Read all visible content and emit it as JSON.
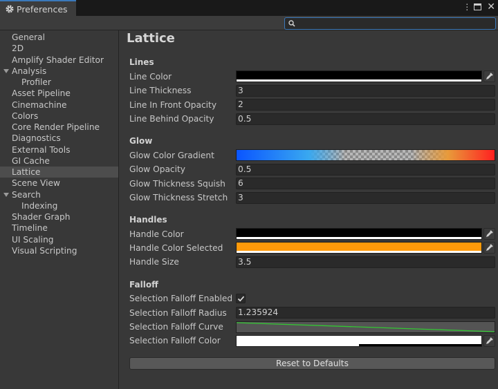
{
  "window": {
    "tab_title": "Preferences",
    "icons": [
      "gear-icon",
      "kebab-menu-icon",
      "maximize-icon",
      "close-icon"
    ]
  },
  "search": {
    "value": "",
    "placeholder": ""
  },
  "sidebar": {
    "items": [
      {
        "label": "General"
      },
      {
        "label": "2D"
      },
      {
        "label": "Amplify Shader Editor"
      },
      {
        "label": "Analysis",
        "expanded": true
      },
      {
        "label": "Profiler",
        "child": true
      },
      {
        "label": "Asset Pipeline"
      },
      {
        "label": "Cinemachine"
      },
      {
        "label": "Colors"
      },
      {
        "label": "Core Render Pipeline"
      },
      {
        "label": "Diagnostics"
      },
      {
        "label": "External Tools"
      },
      {
        "label": "GI Cache"
      },
      {
        "label": "Lattice",
        "selected": true
      },
      {
        "label": "Scene View"
      },
      {
        "label": "Search",
        "expanded": true
      },
      {
        "label": "Indexing",
        "child": true
      },
      {
        "label": "Shader Graph"
      },
      {
        "label": "Timeline"
      },
      {
        "label": "UI Scaling"
      },
      {
        "label": "Visual Scripting"
      }
    ]
  },
  "page": {
    "title": "Lattice",
    "lines": {
      "heading": "Lines",
      "line_color_label": "Line Color",
      "line_color": "#000000",
      "line_thickness_label": "Line Thickness",
      "line_thickness": "3",
      "front_opacity_label": "Line In Front Opacity",
      "front_opacity": "2",
      "behind_opacity_label": "Line Behind Opacity",
      "behind_opacity": "0.5"
    },
    "glow": {
      "heading": "Glow",
      "gradient_label": "Glow Color Gradient",
      "opacity_label": "Glow Opacity",
      "opacity": "0.5",
      "squish_label": "Glow Thickness Squish",
      "squish": "6",
      "stretch_label": "Glow Thickness Stretch",
      "stretch": "3"
    },
    "handles": {
      "heading": "Handles",
      "color_label": "Handle Color",
      "color": "#000000",
      "selected_label": "Handle Color Selected",
      "selected_color": "#ff9a0a",
      "size_label": "Handle Size",
      "size": "3.5"
    },
    "falloff": {
      "heading": "Falloff",
      "enabled_label": "Selection Falloff Enabled",
      "enabled": true,
      "radius_label": "Selection Falloff Radius",
      "radius": "1.235924",
      "curve_label": "Selection Falloff Curve",
      "color_label": "Selection Falloff Color",
      "color": "#ffffff"
    },
    "reset_label": "Reset to Defaults"
  },
  "colors": {
    "accent": "#3a79bb",
    "curve": "#32c832",
    "gradient_start": "#0a55ff",
    "gradient_end": "#ff2020"
  }
}
